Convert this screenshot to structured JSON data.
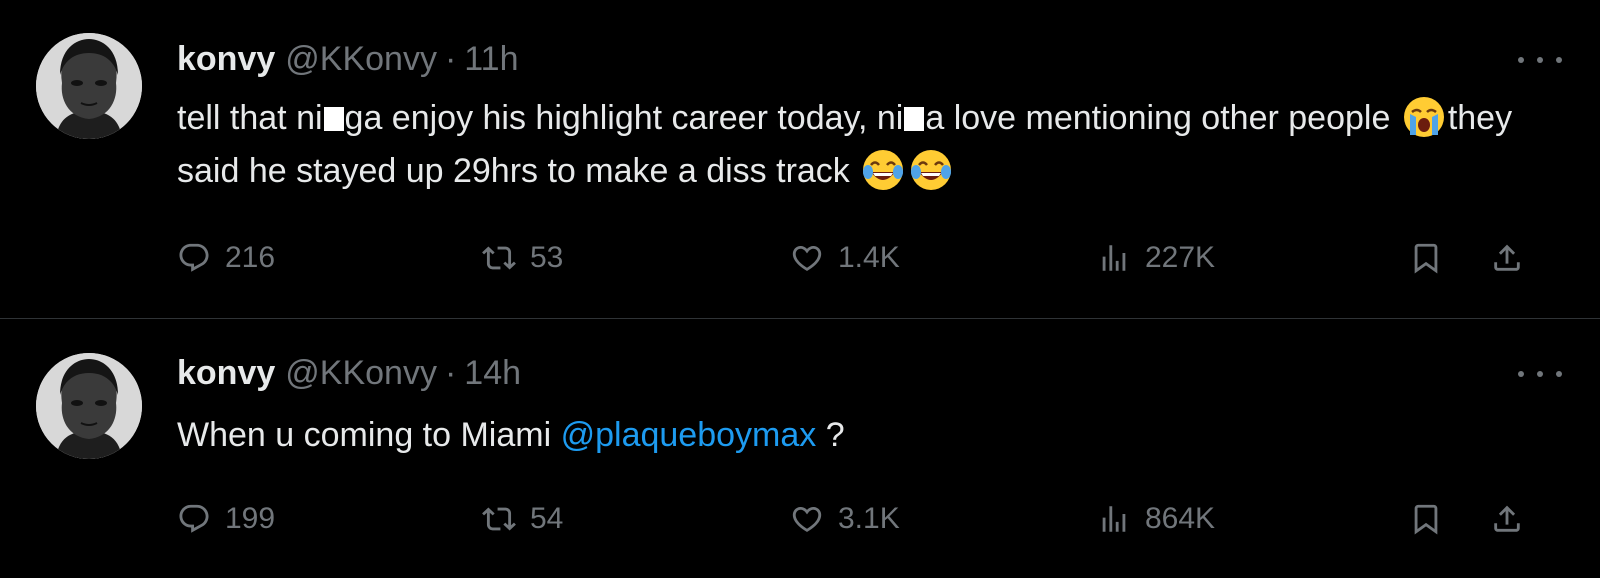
{
  "tweets": [
    {
      "name": "konvy",
      "handle": "@KKonvy",
      "separator": "·",
      "time": "11h",
      "text": {
        "t1": "tell that ni",
        "t2": "ga enjoy his highlight career today, ni",
        "t3": "a love mentioning other people ",
        "t4": "they said he stayed up 29hrs to make a diss track "
      },
      "emojis": [
        "loudly-crying-face",
        "face-with-tears-of-joy",
        "face-with-tears-of-joy"
      ],
      "stats": {
        "replies": "216",
        "reposts": "53",
        "likes": "1.4K",
        "views": "227K"
      }
    },
    {
      "name": "konvy",
      "handle": "@KKonvy",
      "separator": "·",
      "time": "14h",
      "text": {
        "t1": "When u coming to Miami ",
        "mention": "@plaqueboymax",
        "t2": " ?"
      },
      "stats": {
        "replies": "199",
        "reposts": "54",
        "likes": "3.1K",
        "views": "864K"
      }
    }
  ],
  "icons": {
    "reply": "reply-icon",
    "repost": "repost-icon",
    "like": "heart-icon",
    "views": "views-chart-icon",
    "bookmark": "bookmark-icon",
    "share": "share-icon",
    "more": "more-dots-icon"
  },
  "colors": {
    "background": "#000000",
    "primary_text": "#e7e9ea",
    "secondary_text": "#71767b",
    "mention": "#1d9bf0",
    "divider": "#2f3336"
  }
}
